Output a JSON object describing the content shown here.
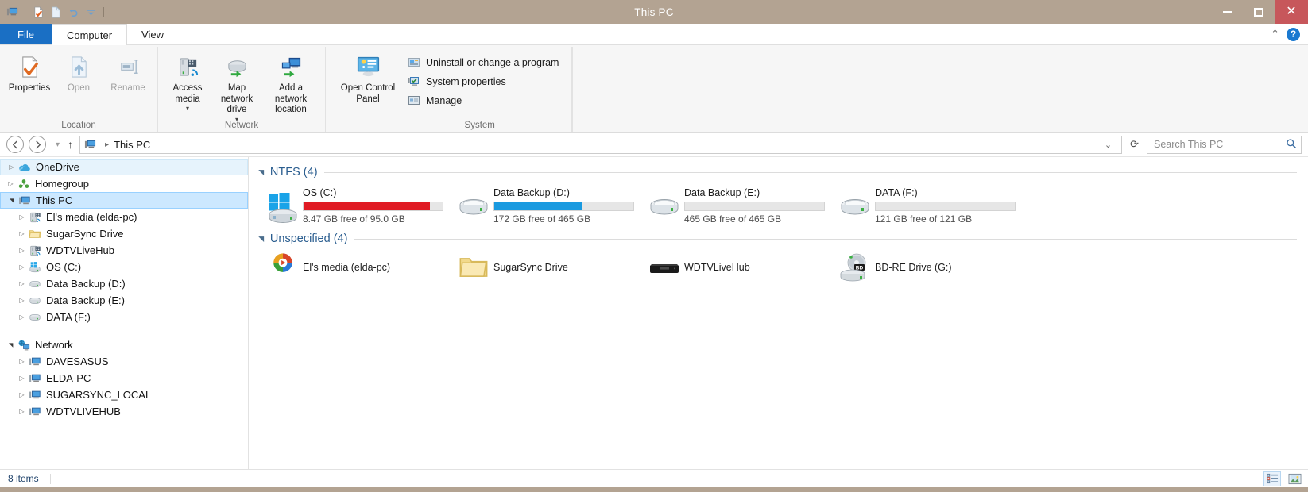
{
  "window": {
    "title": "This PC",
    "minimize_label": "Minimize",
    "maximize_label": "Maximize",
    "close_label": "Close"
  },
  "quick_access_toolbar": {
    "icons": [
      "this-pc-icon",
      "properties-icon",
      "open-icon",
      "undo-icon",
      "customize-dropdown-icon"
    ]
  },
  "tabs": [
    {
      "label": "File",
      "id": "file"
    },
    {
      "label": "Computer",
      "id": "computer"
    },
    {
      "label": "View",
      "id": "view"
    }
  ],
  "tabs_right": {
    "collapse_ribbon": "collapse-ribbon-icon",
    "help": "?"
  },
  "ribbon": {
    "groups": [
      {
        "label": "Location",
        "buttons": [
          {
            "label": "Properties",
            "icon": "properties-icon",
            "disabled": false
          },
          {
            "label": "Open",
            "icon": "open-icon",
            "disabled": true
          },
          {
            "label": "Rename",
            "icon": "rename-icon",
            "disabled": true
          }
        ]
      },
      {
        "label": "Network",
        "buttons": [
          {
            "label": "Access media",
            "icon": "access-media-icon",
            "disabled": false,
            "dropdown": true
          },
          {
            "label": "Map network drive",
            "icon": "map-network-drive-icon",
            "disabled": false,
            "dropdown": true
          },
          {
            "label": "Add a network location",
            "icon": "add-network-location-icon",
            "disabled": false,
            "dropdown": false
          }
        ]
      },
      {
        "label": "System",
        "buttons": [
          {
            "label": "Open Control Panel",
            "icon": "control-panel-icon",
            "disabled": false
          }
        ],
        "small_buttons": [
          {
            "label": "Uninstall or change a program",
            "icon": "uninstall-program-icon"
          },
          {
            "label": "System properties",
            "icon": "system-properties-icon"
          },
          {
            "label": "Manage",
            "icon": "manage-icon"
          }
        ]
      }
    ]
  },
  "addressbar": {
    "back_label": "Back",
    "forward_label": "Forward",
    "recent_label": "Recent locations",
    "up_label": "Up one level",
    "breadcrumb": {
      "icon": "this-pc-icon",
      "text": "This PC"
    },
    "history_label": "Previous locations",
    "refresh_label": "Refresh",
    "search": {
      "placeholder": "Search This PC",
      "value": "",
      "icon": "search-icon"
    }
  },
  "navpane": {
    "items": [
      {
        "label": "OneDrive",
        "icon": "onedrive-icon",
        "indent": 0,
        "arrow": "collapsed",
        "state": "focus"
      },
      {
        "label": "Homegroup",
        "icon": "homegroup-icon",
        "indent": 0,
        "arrow": "collapsed",
        "state": "none"
      },
      {
        "label": "This PC",
        "icon": "this-pc-icon",
        "indent": 0,
        "arrow": "expanded",
        "state": "selected"
      },
      {
        "label": "El's media (elda-pc)",
        "icon": "media-server-icon",
        "indent": 1,
        "arrow": "collapsed",
        "state": "none"
      },
      {
        "label": "SugarSync Drive",
        "icon": "folder-icon",
        "indent": 1,
        "arrow": "collapsed",
        "state": "none"
      },
      {
        "label": "WDTVLiveHub",
        "icon": "media-server-icon",
        "indent": 1,
        "arrow": "collapsed",
        "state": "none"
      },
      {
        "label": "OS (C:)",
        "icon": "windows-drive-icon",
        "indent": 1,
        "arrow": "collapsed",
        "state": "none"
      },
      {
        "label": "Data Backup (D:)",
        "icon": "drive-icon",
        "indent": 1,
        "arrow": "collapsed",
        "state": "none"
      },
      {
        "label": "Data Backup (E:)",
        "icon": "drive-icon",
        "indent": 1,
        "arrow": "collapsed",
        "state": "none"
      },
      {
        "label": "DATA (F:)",
        "icon": "drive-icon",
        "indent": 1,
        "arrow": "collapsed",
        "state": "none"
      },
      {
        "label": "",
        "icon": "",
        "indent": 0,
        "arrow": "none",
        "state": "spacer"
      },
      {
        "label": "Network",
        "icon": "network-icon",
        "indent": 0,
        "arrow": "expanded",
        "state": "none"
      },
      {
        "label": "DAVESASUS",
        "icon": "computer-icon",
        "indent": 1,
        "arrow": "collapsed",
        "state": "none"
      },
      {
        "label": "ELDA-PC",
        "icon": "computer-icon",
        "indent": 1,
        "arrow": "collapsed",
        "state": "none"
      },
      {
        "label": "SUGARSYNC_LOCAL",
        "icon": "computer-icon",
        "indent": 1,
        "arrow": "collapsed",
        "state": "none"
      },
      {
        "label": "WDTVLIVEHUB",
        "icon": "computer-icon",
        "indent": 1,
        "arrow": "collapsed",
        "state": "none"
      }
    ]
  },
  "content": {
    "groups": [
      {
        "header": "NTFS (4)",
        "kind": "drives",
        "items": [
          {
            "name": "OS (C:)",
            "sub": "8.47 GB free of 95.0 GB",
            "icon": "windows-drive-icon",
            "used_percent": 91,
            "bar_color": "#e01b24"
          },
          {
            "name": "Data Backup (D:)",
            "sub": "172 GB free of 465 GB",
            "icon": "drive-icon",
            "used_percent": 63,
            "bar_color": "#1a9ae0"
          },
          {
            "name": "Data Backup (E:)",
            "sub": "465 GB free of 465 GB",
            "icon": "drive-icon",
            "used_percent": 0,
            "bar_color": "#1a9ae0"
          },
          {
            "name": "DATA (F:)",
            "sub": "121 GB free of 121 GB",
            "icon": "drive-icon",
            "used_percent": 0,
            "bar_color": "#1a9ae0"
          }
        ]
      },
      {
        "header": "Unspecified (4)",
        "kind": "simple",
        "items": [
          {
            "name": "El's media (elda-pc)",
            "icon": "windows-media-player-icon"
          },
          {
            "name": "SugarSync Drive",
            "icon": "folder-icon"
          },
          {
            "name": "WDTVLiveHub",
            "icon": "set-top-box-icon"
          },
          {
            "name": "BD-RE Drive (G:)",
            "icon": "bd-re-drive-icon"
          }
        ]
      }
    ]
  },
  "statusbar": {
    "count": "8 items",
    "view_details_label": "Details view",
    "view_large_icons_label": "Large icons view"
  },
  "colors": {
    "titlebar": "#b3a392",
    "file_tab": "#1a6fc4",
    "close_button": "#c7575b",
    "group_header_text": "#2a5d8f",
    "selection": "#cce8ff",
    "bar_red": "#e01b24",
    "bar_blue": "#1a9ae0"
  }
}
